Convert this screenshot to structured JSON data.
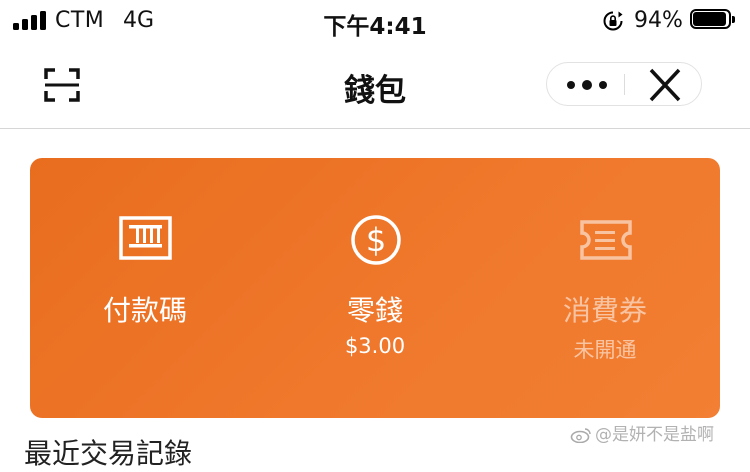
{
  "status_bar": {
    "carrier": "CTM",
    "network": "4G",
    "time": "下午4:41",
    "battery_percent": "94%",
    "battery_level": 0.94
  },
  "nav": {
    "title": "錢包",
    "left_icon": "scan-icon",
    "capsule": {
      "more_icon": "more-dots-icon",
      "close_icon": "close-icon"
    }
  },
  "wallet_card": {
    "background_color": "#ec7425",
    "entries": [
      {
        "label": "付款碼",
        "sub": "",
        "icon": "payment-code-icon",
        "enabled": true
      },
      {
        "label": "零錢",
        "sub": "$3.00",
        "icon": "dollar-coin-icon",
        "enabled": true
      },
      {
        "label": "消費券",
        "sub": "未開通",
        "icon": "ticket-icon",
        "enabled": false
      }
    ]
  },
  "recent": {
    "heading": "最近交易記錄"
  },
  "watermark": {
    "text": "@是妍不是盐啊"
  }
}
